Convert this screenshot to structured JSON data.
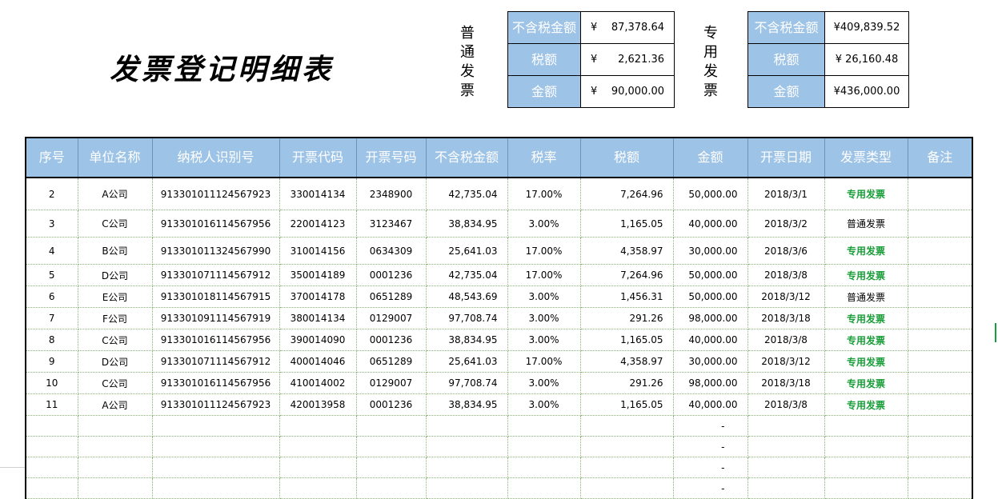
{
  "title": "发票登记明细表",
  "summary": {
    "normal": {
      "label": "普\n通\n发\n票",
      "rows": [
        {
          "label": "不含税金额",
          "currency": "¥",
          "value": "87,378.64"
        },
        {
          "label": "税额",
          "currency": "¥",
          "value": "2,621.36"
        },
        {
          "label": "金额",
          "currency": "¥",
          "value": "90,000.00"
        }
      ]
    },
    "special": {
      "label": "专\n用\n发\n票",
      "rows": [
        {
          "label": "不含税金额",
          "value": "¥409,839.52"
        },
        {
          "label": "税额",
          "value": "¥ 26,160.48"
        },
        {
          "label": "金额",
          "value": "¥436,000.00"
        }
      ]
    }
  },
  "columns": [
    "序号",
    "单位名称",
    "纳税人识别号",
    "开票代码",
    "开票号码",
    "不含税金额",
    "税率",
    "税额",
    "金额",
    "开票日期",
    "发票类型",
    "备注"
  ],
  "rows": [
    {
      "no": "2",
      "company": "A公司",
      "taxid": "913301011124567923",
      "code": "330014134",
      "number": "2348900",
      "pretax": "42,735.04",
      "rate": "17.00%",
      "tax": "7,264.96",
      "amount": "50,000.00",
      "date": "2018/3/1",
      "type": "专用发票",
      "special": true,
      "note": ""
    },
    {
      "no": "3",
      "company": "C公司",
      "taxid": "913301016114567956",
      "code": "220014123",
      "number": "3123467",
      "pretax": "38,834.95",
      "rate": "3.00%",
      "tax": "1,165.05",
      "amount": "40,000.00",
      "date": "2018/3/2",
      "type": "普通发票",
      "special": false,
      "note": ""
    },
    {
      "no": "4",
      "company": "B公司",
      "taxid": "913301011324567990",
      "code": "310014156",
      "number": "0634309",
      "pretax": "25,641.03",
      "rate": "17.00%",
      "tax": "4,358.97",
      "amount": "30,000.00",
      "date": "2018/3/6",
      "type": "专用发票",
      "special": true,
      "note": ""
    },
    {
      "no": "5",
      "company": "D公司",
      "taxid": "913301071114567912",
      "code": "350014189",
      "number": "0001236",
      "pretax": "42,735.04",
      "rate": "17.00%",
      "tax": "7,264.96",
      "amount": "50,000.00",
      "date": "2018/3/8",
      "type": "专用发票",
      "special": true,
      "note": ""
    },
    {
      "no": "6",
      "company": "E公司",
      "taxid": "913301018114567915",
      "code": "370014178",
      "number": "0651289",
      "pretax": "48,543.69",
      "rate": "3.00%",
      "tax": "1,456.31",
      "amount": "50,000.00",
      "date": "2018/3/12",
      "type": "普通发票",
      "special": false,
      "note": ""
    },
    {
      "no": "7",
      "company": "F公司",
      "taxid": "913301091114567919",
      "code": "380014134",
      "number": "0129007",
      "pretax": "97,708.74",
      "rate": "3.00%",
      "tax": "291.26",
      "amount": "98,000.00",
      "date": "2018/3/18",
      "type": "专用发票",
      "special": true,
      "note": ""
    },
    {
      "no": "8",
      "company": "C公司",
      "taxid": "913301016114567956",
      "code": "390014090",
      "number": "0001236",
      "pretax": "38,834.95",
      "rate": "3.00%",
      "tax": "1,165.05",
      "amount": "40,000.00",
      "date": "2018/3/8",
      "type": "专用发票",
      "special": true,
      "note": ""
    },
    {
      "no": "9",
      "company": "D公司",
      "taxid": "913301071114567912",
      "code": "400014046",
      "number": "0651289",
      "pretax": "25,641.03",
      "rate": "17.00%",
      "tax": "4,358.97",
      "amount": "30,000.00",
      "date": "2018/3/12",
      "type": "专用发票",
      "special": true,
      "note": ""
    },
    {
      "no": "10",
      "company": "C公司",
      "taxid": "913301016114567956",
      "code": "410014002",
      "number": "0129007",
      "pretax": "97,708.74",
      "rate": "3.00%",
      "tax": "291.26",
      "amount": "98,000.00",
      "date": "2018/3/18",
      "type": "专用发票",
      "special": true,
      "note": ""
    },
    {
      "no": "11",
      "company": "A公司",
      "taxid": "913301011124567923",
      "code": "420013958",
      "number": "0001236",
      "pretax": "38,834.95",
      "rate": "3.00%",
      "tax": "1,165.05",
      "amount": "40,000.00",
      "date": "2018/3/8",
      "type": "专用发票",
      "special": true,
      "note": ""
    }
  ],
  "empty_rows": [
    {
      "amount": "-"
    },
    {
      "amount": "-"
    },
    {
      "amount": "-"
    },
    {
      "amount": "-"
    }
  ],
  "colors": {
    "header_bg": "#9dc3e6",
    "special_type": "#1a9e3a"
  }
}
